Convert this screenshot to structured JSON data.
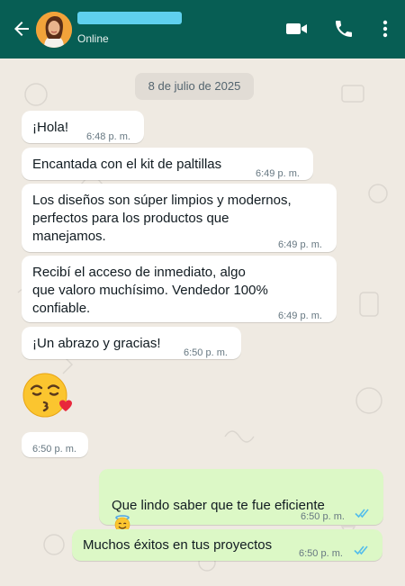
{
  "header": {
    "status": "Online",
    "colors": {
      "bar": "#075e54",
      "avatar": "#f2a33a",
      "name_redaction": "#5fd0ee"
    },
    "icons": [
      "back-arrow-icon",
      "avatar",
      "video-call-icon",
      "phone-call-icon",
      "more-options-icon"
    ]
  },
  "chat": {
    "date": "8 de julio de 2025",
    "messages": [
      {
        "direction": "in",
        "text": "¡Hola!",
        "time": "6:48 p. m."
      },
      {
        "direction": "in",
        "text": "Encantada con el kit de paltillas",
        "time": "6:49 p. m."
      },
      {
        "direction": "in",
        "text": "Los diseños son súper limpios y modernos,\nperfectos para los productos que\nmanejamos.",
        "time": "6:49 p. m."
      },
      {
        "direction": "in",
        "text": "Recibí el acceso de inmediato, algo\nque valoro muchísimo. Vendedor 100%\nconfiable.",
        "time": "6:49 p. m."
      },
      {
        "direction": "in",
        "text": "¡Un abrazo y gracias!",
        "time": "6:50 p. m."
      },
      {
        "direction": "in",
        "emoji": "kissing-face-with-heart",
        "time": "6:50 p. m."
      },
      {
        "direction": "out",
        "text": "Que lindo saber que te fue eficiente",
        "emoji": "smiling-face-with-halo",
        "time": "6:50 p. m.",
        "read": true
      },
      {
        "direction": "out",
        "text": "Muchos éxitos en tus proyectos",
        "time": "6:50 p. m.",
        "read": true
      }
    ],
    "colors": {
      "incoming": "#ffffff",
      "outgoing": "#dcf8c6",
      "read_ticks": "#53bdeb",
      "background": "#efeae2"
    }
  }
}
